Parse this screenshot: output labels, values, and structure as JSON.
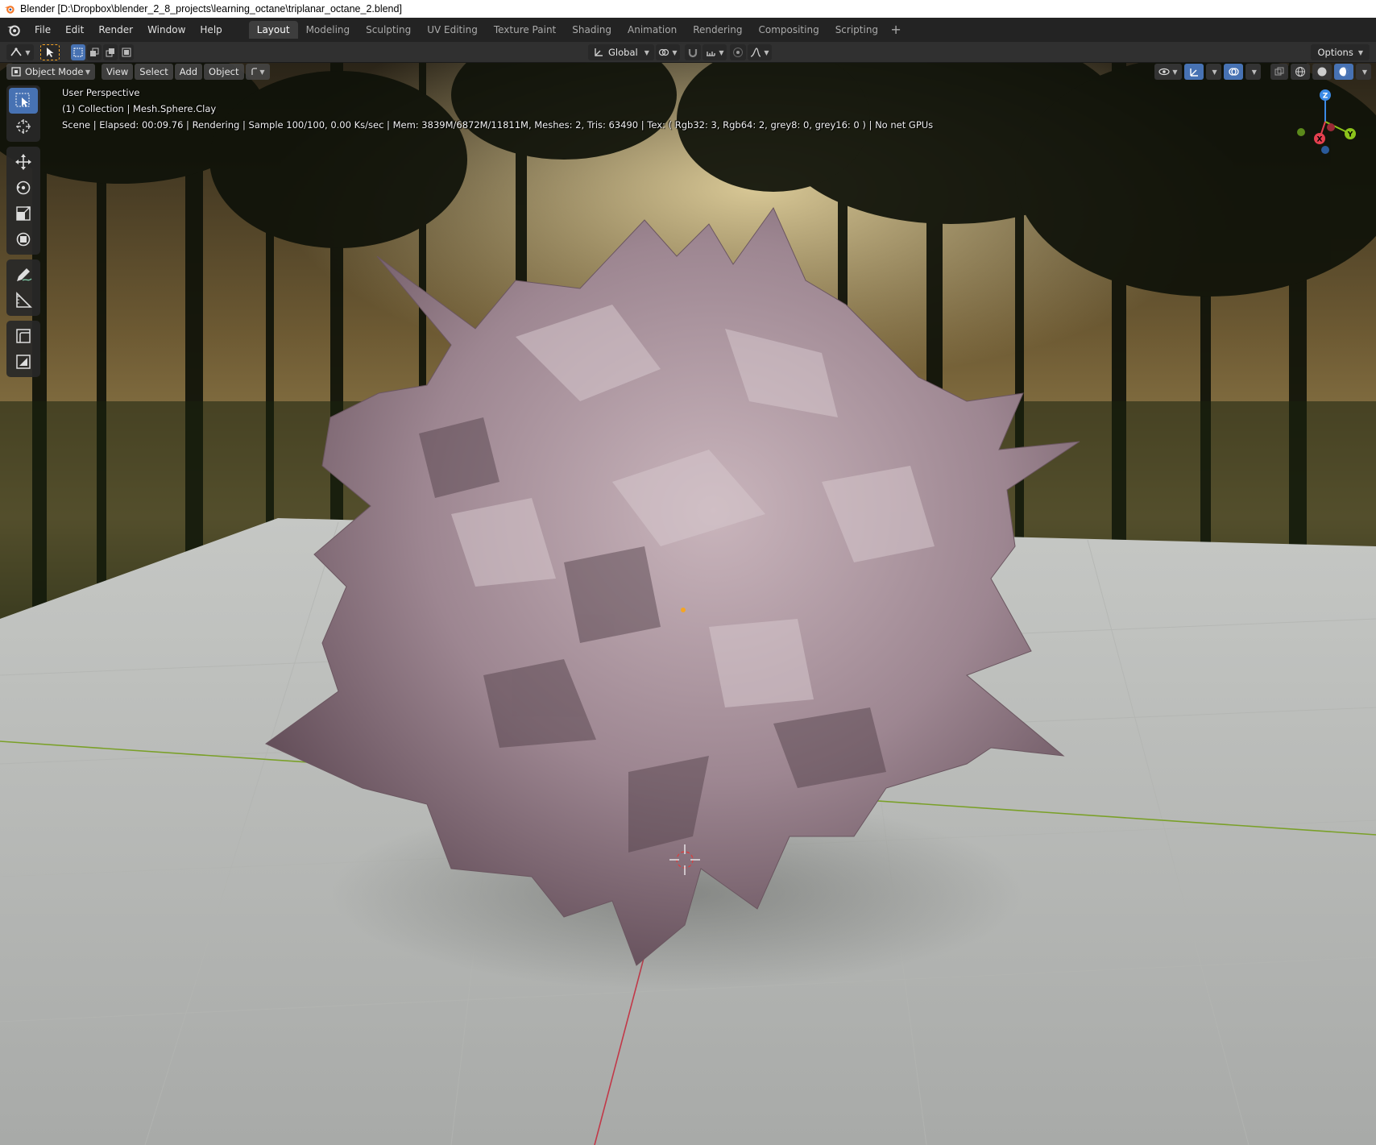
{
  "window": {
    "title": "Blender [D:\\Dropbox\\blender_2_8_projects\\learning_octane\\triplanar_octane_2.blend]"
  },
  "menu": {
    "items": [
      "File",
      "Edit",
      "Render",
      "Window",
      "Help"
    ]
  },
  "workspaces": {
    "tabs": [
      "Layout",
      "Modeling",
      "Sculpting",
      "UV Editing",
      "Texture Paint",
      "Shading",
      "Animation",
      "Rendering",
      "Compositing",
      "Scripting"
    ],
    "active": "Layout",
    "add_label": "+"
  },
  "toolheader": {
    "orientation": "Global",
    "options_label": "Options"
  },
  "viewport_header": {
    "mode": "Object Mode",
    "view": "View",
    "select": "Select",
    "add": "Add",
    "object": "Object"
  },
  "overlay": {
    "perspective": "User Perspective",
    "collection": "(1) Collection | Mesh.Sphere.Clay",
    "status": "Scene | Elapsed: 00:09.76 |   Rendering | Sample 100/100, 0.00 Ks/sec | Mem: 3839M/6872M/11811M, Meshes: 2, Tris: 63490 | Tex: ( Rgb32: 3, Rgb64: 2, grey8: 0, grey16: 0 ) | No net GPUs"
  },
  "gizmo": {
    "x_label": "X",
    "y_label": "Y",
    "z_label": "Z",
    "x_color": "#e5404f",
    "y_color": "#8cc31b",
    "z_color": "#3b8ae6"
  },
  "tools": [
    "select-box",
    "cursor",
    "move",
    "rotate",
    "scale",
    "transform",
    "annotate",
    "measure",
    "add-cube",
    "add-plane"
  ],
  "colors": {
    "accent": "#4772b3",
    "header_bg": "#232323",
    "panel_bg": "#303030"
  }
}
